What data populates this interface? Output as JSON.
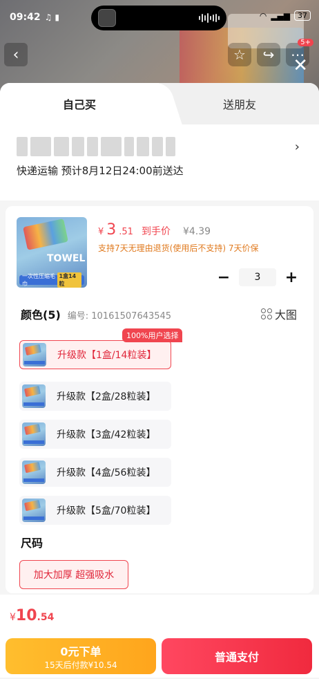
{
  "status_bar": {
    "time": "09:42",
    "battery": "37",
    "notification_badge": "5+"
  },
  "tabs": {
    "self": "自己买",
    "friend": "送朋友"
  },
  "delivery": {
    "text": "快递运输 预计8月12日24:00前送达"
  },
  "product": {
    "thumb_label": "TOWEL",
    "thumb_bar_left": "一次性压缩毛巾",
    "thumb_bar_right": "1盒14粒",
    "price_currency": "¥",
    "price_int": "3",
    "price_dec": ".51",
    "price_tag": "到手价",
    "price_original": "¥4.39",
    "guarantee": "支持7天无理由退货(使用后不支持) 7天价保",
    "quantity": "3"
  },
  "color": {
    "title": "颜色(5)",
    "code": "编号: 10161507643545",
    "big_view": "大图",
    "preferred_tag": "100%用户选择",
    "variants": [
      {
        "label": "升级款【1盒/14粒装】"
      },
      {
        "label": "升级款【2盒/28粒装】"
      },
      {
        "label": "升级款【3盒/42粒装】"
      },
      {
        "label": "升级款【4盒/56粒装】"
      },
      {
        "label": "升级款【5盒/70粒装】"
      }
    ]
  },
  "size": {
    "title": "尺码",
    "option": "加大加厚 超强吸水"
  },
  "bottom": {
    "total_currency": "¥",
    "total_int": "10",
    "total_dec": ".54",
    "later_line1": "0元下单",
    "later_line2": "15天后付款¥10.54",
    "pay_label": "普通支付"
  }
}
